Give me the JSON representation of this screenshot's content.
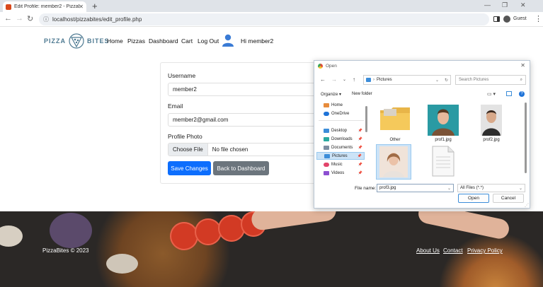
{
  "browser": {
    "tab_title": "Edit Profile: member2 - PizzaBites",
    "url": "localhost/pizzabites/edit_profile.php",
    "profile_label": "Guest"
  },
  "site": {
    "logo_left": "PIZZA",
    "logo_right": "BITES",
    "nav": [
      "Home",
      "Pizzas",
      "Dashboard",
      "Cart",
      "Log Out"
    ],
    "greeting": "Hi member2"
  },
  "form": {
    "username_label": "Username",
    "username_value": "member2",
    "email_label": "Email",
    "email_value": "member2@gmail.com",
    "photo_label": "Profile Photo",
    "choose_file": "Choose File",
    "no_file": "No file chosen",
    "save_label": "Save Changes",
    "back_label": "Back to Dashboard",
    "save_color": "#0d6efd",
    "back_color": "#6c757d"
  },
  "footer": {
    "copyright": "PizzaBites © 2023",
    "links": [
      "About Us",
      "Contact",
      "Privacy Policy"
    ]
  },
  "dialog": {
    "title": "Open",
    "path": "Pictures",
    "search_placeholder": "Search Pictures",
    "organize": "Organize",
    "new_folder": "New folder",
    "sidebar": [
      "Home",
      "OneDrive",
      "Desktop",
      "Downloads",
      "Documents",
      "Pictures",
      "Music",
      "Videos"
    ],
    "files": [
      "Other",
      "prof1.jpg",
      "prof2.jpg",
      "",
      ""
    ],
    "filename_label": "File name:",
    "filename_value": "prof3.jpg",
    "filetype": "All Files (*.*)",
    "open_label": "Open",
    "cancel_label": "Cancel"
  }
}
